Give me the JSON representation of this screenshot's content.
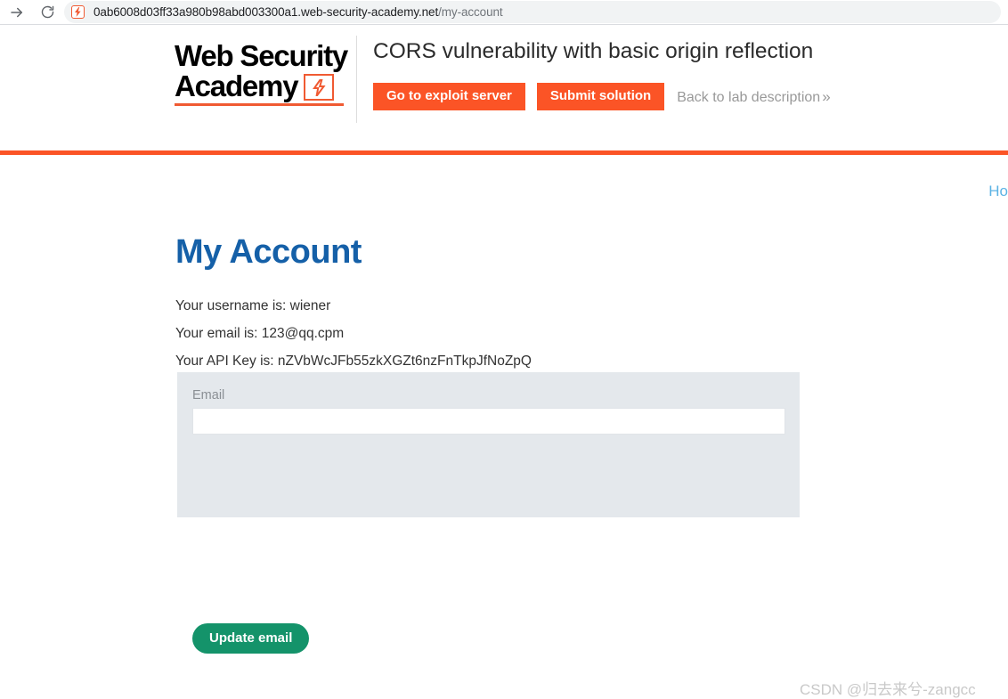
{
  "browser": {
    "forward_icon": "forward-arrow-icon",
    "reload_icon": "reload-icon",
    "favicon": "lightning-bolt-favicon",
    "url_host": "0ab6008d03ff33a980b98abd003300a1.web-security-academy.net",
    "url_path": "/my-account"
  },
  "lab_header": {
    "logo_line1": "Web Security",
    "logo_line2": "Academy",
    "logo_bolt_icon": "lightning-bolt-icon",
    "title": "CORS vulnerability with basic origin reflection",
    "exploit_button": "Go to exploit server",
    "submit_button": "Submit solution",
    "back_link": "Back to lab description",
    "back_chevron": "»"
  },
  "page": {
    "home_link": "Ho",
    "heading": "My Account",
    "username_line": "Your username is: wiener",
    "email_line": "Your email is: 123@qq.cpm",
    "apikey_line": "Your API Key is: nZVbWcJFb55zkXGZt6nzFnTkpJfNoZpQ",
    "form": {
      "label": "Email",
      "input_value": "",
      "input_placeholder": "",
      "submit_label": "Update email"
    }
  },
  "watermark": "CSDN @归去来兮-zangcc",
  "colors": {
    "brand_orange": "#fb5426",
    "heading_blue": "#1560a8",
    "button_green": "#14936a",
    "panel_gray": "#e4e8ec",
    "link_blue": "#5cb3e4"
  }
}
